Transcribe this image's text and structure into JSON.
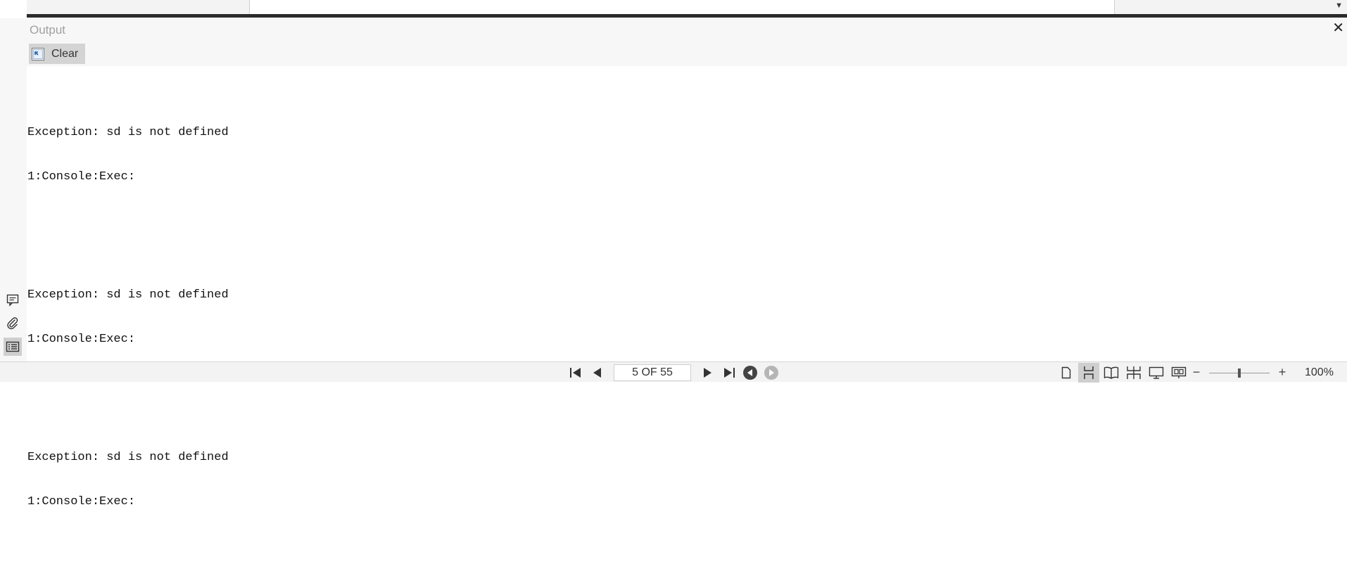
{
  "output_panel": {
    "title": "Output",
    "clear_label": "Clear",
    "close_glyph": "✕",
    "log": [
      {
        "message": "Exception: sd is not defined",
        "source": "1:Console:Exec:"
      },
      {
        "message": "Exception: sd is not defined",
        "source": "1:Console:Exec:"
      },
      {
        "message": "Exception: sd is not defined",
        "source": "1:Console:Exec:"
      }
    ]
  },
  "sidebar": {
    "icons": [
      "comment-icon",
      "attachment-icon",
      "output-panel-icon"
    ],
    "active": "output-panel-icon"
  },
  "status_bar": {
    "page_indicator": "5 OF 55",
    "zoom_minus": "−",
    "zoom_plus": "+",
    "zoom_value": "100%",
    "zoom_level": 1.0,
    "view_modes": [
      "single-page-icon",
      "continuous-icon",
      "two-page-icon",
      "two-page-continuous-icon",
      "presentation-icon",
      "slideshow-icon"
    ],
    "active_view": "continuous-icon",
    "nav_icons": [
      "first-page-icon",
      "previous-page-icon",
      "next-page-icon",
      "last-page-icon",
      "back-icon",
      "forward-icon"
    ]
  },
  "colors": {
    "dark_bar": "#2b2b2b",
    "panel_bg": "#f7f7f7",
    "active_bg": "#cfcfcf"
  }
}
